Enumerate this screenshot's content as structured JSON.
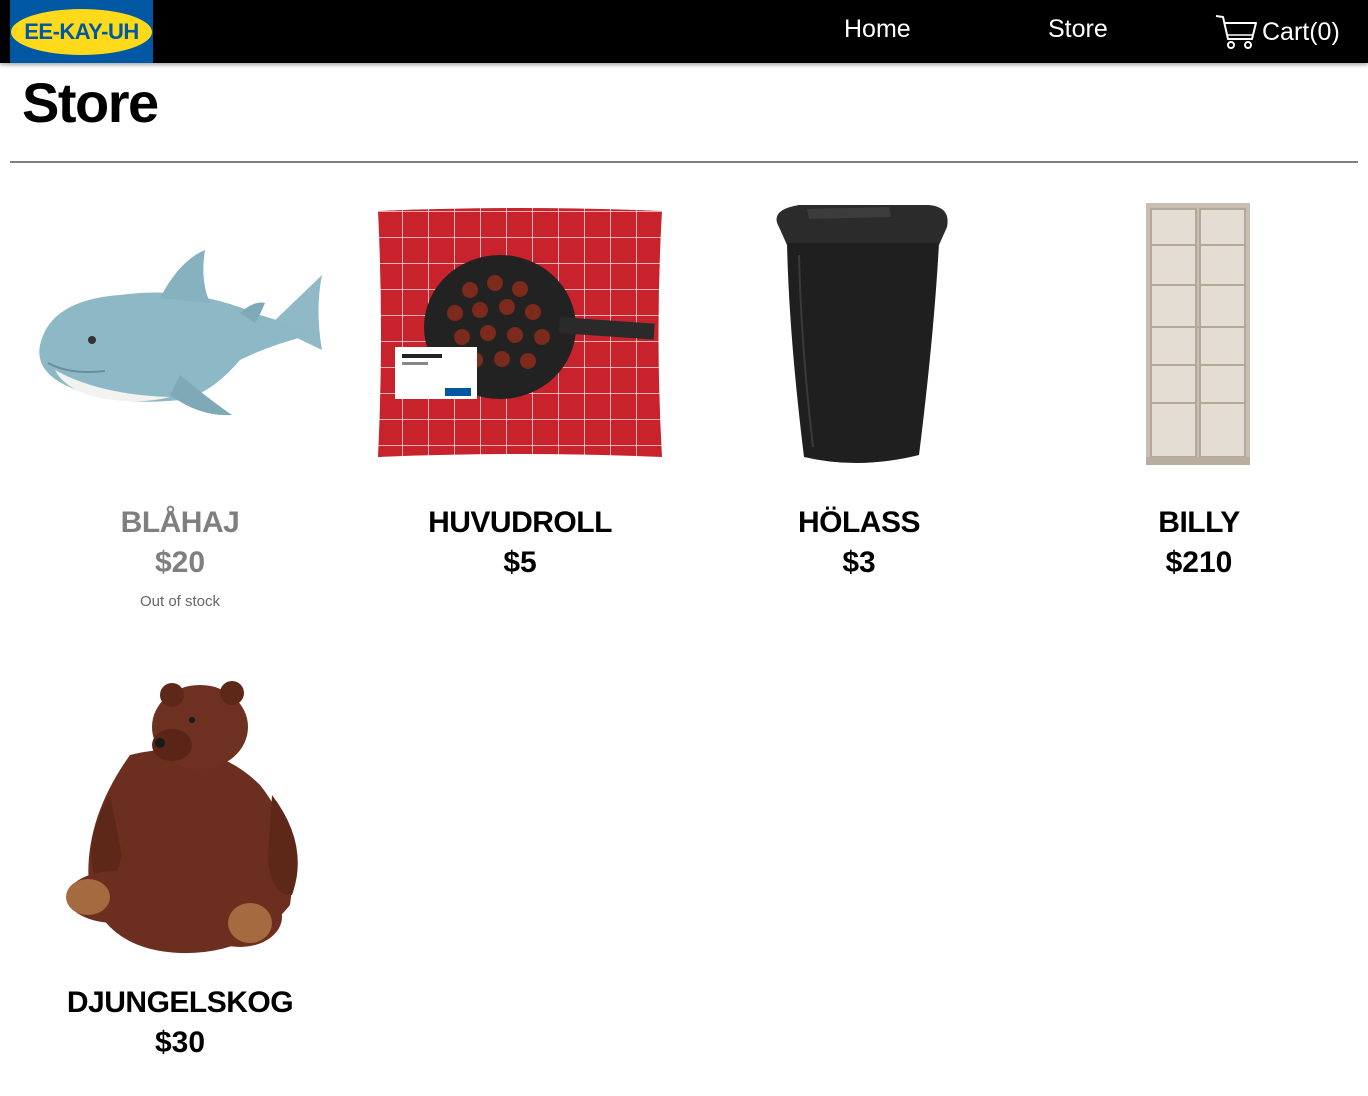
{
  "nav": {
    "logo_text": "EE-KAY-UH",
    "links": [
      {
        "label": "Home"
      },
      {
        "label": "Store"
      }
    ],
    "cart_label": "Cart(0)",
    "cart_icon": "shopping-cart-icon"
  },
  "page": {
    "title": "Store"
  },
  "products": [
    {
      "name": "BLÅHAJ",
      "price": "$20",
      "stock_note": "Out of stock",
      "image": "shark-plush"
    },
    {
      "name": "HUVUDROLL",
      "price": "$5",
      "image": "meatballs-package"
    },
    {
      "name": "HÖLASS",
      "price": "$3",
      "image": "trash-bin"
    },
    {
      "name": "BILLY",
      "price": "$210",
      "image": "glass-door-bookcase"
    },
    {
      "name": "DJUNGELSKOG",
      "price": "$30",
      "image": "bear-plush"
    }
  ],
  "colors": {
    "navbar_bg": "#000000",
    "logo_blue": "#0058a3",
    "logo_yellow": "#ffda1a",
    "out_of_stock_text": "#7f7f7f"
  }
}
